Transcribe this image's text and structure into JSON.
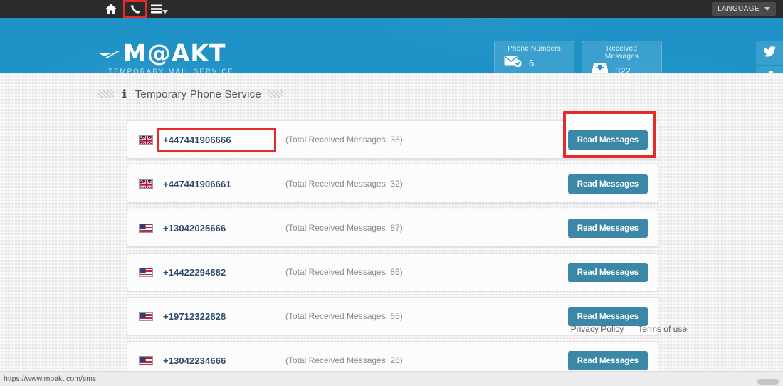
{
  "navbar": {
    "home_label": "home-icon",
    "phone_label": "phone-icon",
    "menu_label": "hamburger-menu-icon",
    "language_label": "LANGUAGE"
  },
  "header": {
    "logo_text": "M@AKT",
    "logo_tagline": "TEMPORARY MAIL SERVICE",
    "stats": [
      {
        "title": "Phone Numbers",
        "value": "6",
        "icon": "envelope-check-icon"
      },
      {
        "title": "Received Messages",
        "value": "322",
        "icon": "inbox-download-icon"
      }
    ],
    "social": [
      {
        "name": "twitter-icon"
      },
      {
        "name": "facebook-icon"
      }
    ]
  },
  "main": {
    "page_title": "Temporary Phone Service",
    "info_icon": "info-icon",
    "read_button_label": "Read Messages",
    "rows": [
      {
        "flag": "gb",
        "number": "+447441906666",
        "count_text": "(Total Received Messages: 36)",
        "highlighted": true
      },
      {
        "flag": "gb",
        "number": "+447441906661",
        "count_text": "(Total Received Messages: 32)",
        "highlighted": false
      },
      {
        "flag": "us",
        "number": "+13042025666",
        "count_text": "(Total Received Messages: 87)",
        "highlighted": false
      },
      {
        "flag": "us",
        "number": "+14422294882",
        "count_text": "(Total Received Messages: 86)",
        "highlighted": false
      },
      {
        "flag": "us",
        "number": "+19712322828",
        "count_text": "(Total Received Messages: 55)",
        "highlighted": false
      },
      {
        "flag": "us",
        "number": "+13042234666",
        "count_text": "(Total Received Messages: 26)",
        "highlighted": false
      }
    ]
  },
  "footer": {
    "privacy_label": "Privacy Policy",
    "terms_label": "Terms of use"
  },
  "statusbar": {
    "url": "https://www.moakt.com/sms"
  },
  "colors": {
    "navbar": "#2b2b2b",
    "header_blue": "#1e92c6",
    "button_blue": "#3a87a8",
    "highlight_red": "#e52b2b",
    "number_text": "#2e4a6b"
  }
}
